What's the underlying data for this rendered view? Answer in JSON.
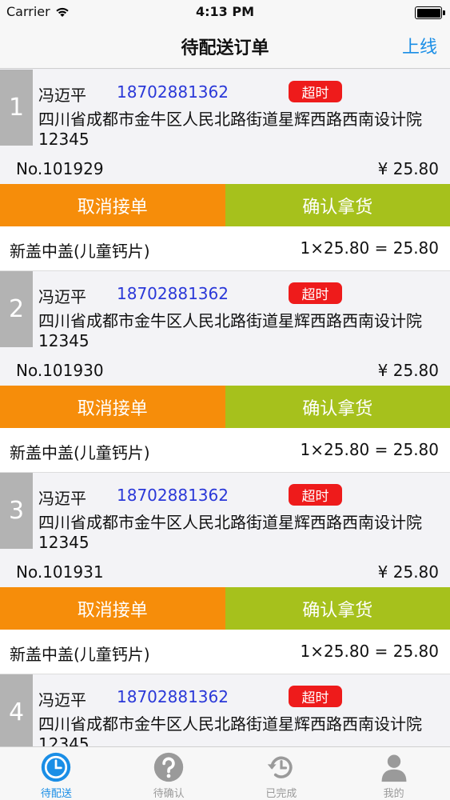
{
  "status": {
    "carrier": "Carrier",
    "time": "4:13 PM"
  },
  "nav": {
    "title": "待配送订单",
    "action": "上线"
  },
  "orders": [
    {
      "index": "1",
      "name": "冯迈平",
      "phone": "18702881362",
      "badge": "超时",
      "address": "四川省成都市金牛区人民北路街道星辉西路西南设计院12345",
      "order_no": "No.101929",
      "price": "¥ 25.80",
      "cancel_label": "取消接单",
      "confirm_label": "确认拿货",
      "item_name": "新盖中盖(儿童钙片)",
      "item_calc": "1×25.80 = 25.80"
    },
    {
      "index": "2",
      "name": "冯迈平",
      "phone": "18702881362",
      "badge": "超时",
      "address": "四川省成都市金牛区人民北路街道星辉西路西南设计院12345",
      "order_no": "No.101930",
      "price": "¥ 25.80",
      "cancel_label": "取消接单",
      "confirm_label": "确认拿货",
      "item_name": "新盖中盖(儿童钙片)",
      "item_calc": "1×25.80 = 25.80"
    },
    {
      "index": "3",
      "name": "冯迈平",
      "phone": "18702881362",
      "badge": "超时",
      "address": "四川省成都市金牛区人民北路街道星辉西路西南设计院12345",
      "order_no": "No.101931",
      "price": "¥ 25.80",
      "cancel_label": "取消接单",
      "confirm_label": "确认拿货",
      "item_name": "新盖中盖(儿童钙片)",
      "item_calc": "1×25.80 = 25.80"
    },
    {
      "index": "4",
      "name": "冯迈平",
      "phone": "18702881362",
      "badge": "超时",
      "address": "四川省成都市金牛区人民北路街道星辉西路西南设计院12345"
    }
  ],
  "tabs": [
    {
      "label": "待配送",
      "icon": "clock-icon"
    },
    {
      "label": "待确认",
      "icon": "question-icon"
    },
    {
      "label": "已完成",
      "icon": "history-icon"
    },
    {
      "label": "我的",
      "icon": "user-icon"
    }
  ],
  "colors": {
    "accent": "#1a8ee6",
    "cancel": "#f68d0a",
    "confirm": "#a6c11c",
    "badge": "#ee1b1b",
    "phone": "#2a38d8"
  }
}
